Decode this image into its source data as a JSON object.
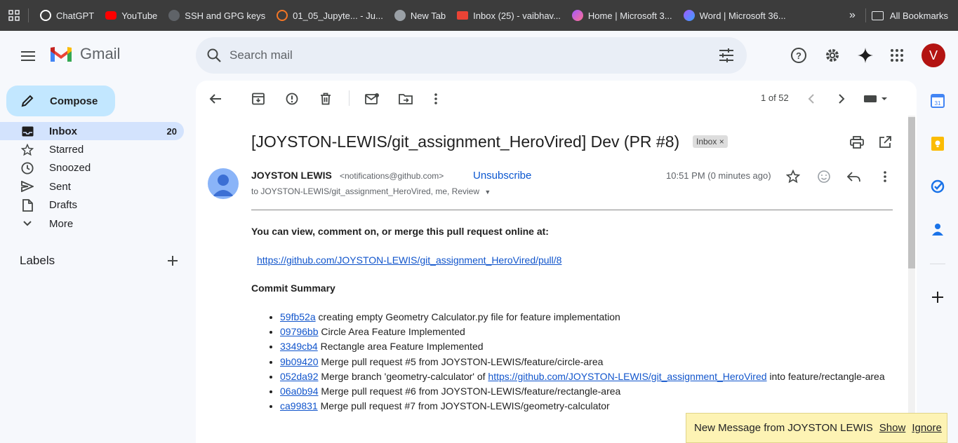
{
  "bookmarks": {
    "items": [
      {
        "label": "ChatGPT",
        "color": "#ffffff"
      },
      {
        "label": "YouTube",
        "color": "#ff0000"
      },
      {
        "label": "SSH and GPG keys",
        "color": "#9aa0a6"
      },
      {
        "label": "01_05_Jupyte... - Ju...",
        "color": "#f37626"
      },
      {
        "label": "New Tab",
        "color": "#9aa0a6"
      },
      {
        "label": "Inbox (25) - vaibhav...",
        "color": "#ea4335"
      },
      {
        "label": "Home | Microsoft 3...",
        "color": "#a259ff"
      },
      {
        "label": "Word | Microsoft 36...",
        "color": "#a259ff"
      }
    ],
    "more": "»",
    "all_label": "All Bookmarks"
  },
  "header": {
    "logo_text": "Gmail",
    "search_placeholder": "Search mail",
    "avatar_letter": "V"
  },
  "sidebar": {
    "compose_label": "Compose",
    "items": [
      {
        "label": "Inbox",
        "count": "20"
      },
      {
        "label": "Starred",
        "count": ""
      },
      {
        "label": "Snoozed",
        "count": ""
      },
      {
        "label": "Sent",
        "count": ""
      },
      {
        "label": "Drafts",
        "count": ""
      },
      {
        "label": "More",
        "count": ""
      }
    ],
    "labels_heading": "Labels"
  },
  "toolbar": {
    "pager_text": "1 of 52"
  },
  "email": {
    "subject": "[JOYSTON-LEWIS/git_assignment_HeroVired] Dev (PR #8)",
    "inbox_chip": "Inbox ×",
    "sender_name": "JOYSTON LEWIS",
    "sender_email": "<notifications@github.com>",
    "unsubscribe": "Unsubscribe",
    "to_line": "to JOYSTON-LEWIS/git_assignment_HeroVired, me, Review",
    "time": "10:51 PM (0 minutes ago)",
    "intro": "You can view, comment on, or merge this pull request online at:",
    "pr_link": "https://github.com/JOYSTON-LEWIS/git_assignment_HeroVired/pull/8",
    "commit_heading": "Commit Summary",
    "commits": [
      {
        "sha": "59fb52a",
        "text": " creating empty Geometry Calculator.py file for feature implementation"
      },
      {
        "sha": "09796bb",
        "text": " Circle Area Feature Implemented"
      },
      {
        "sha": "3349cb4",
        "text": " Rectangle area Feature Implemented"
      },
      {
        "sha": "9b09420",
        "text": " Merge pull request #5 from JOYSTON-LEWIS/feature/circle-area"
      },
      {
        "sha": "052da92",
        "text": " Merge branch 'geometry-calculator' of ",
        "link": "https://github.com/JOYSTON-LEWIS/git_assignment_HeroVired",
        "after": " into feature/rectangle-area"
      },
      {
        "sha": "06a0b94",
        "text": " Merge pull request #6 from JOYSTON-LEWIS/feature/rectangle-area"
      },
      {
        "sha": "ca99831",
        "text": " Merge pull request #7 from JOYSTON-LEWIS/geometry-calculator"
      }
    ]
  },
  "notification": {
    "text": "New Message from JOYSTON LEWIS",
    "show": "Show",
    "ignore": "Ignore"
  },
  "colors": {
    "accent": "#0b57d0",
    "compose_bg": "#c2e7ff",
    "active_nav": "#d3e3fd",
    "avatar_bg": "#b31412"
  }
}
